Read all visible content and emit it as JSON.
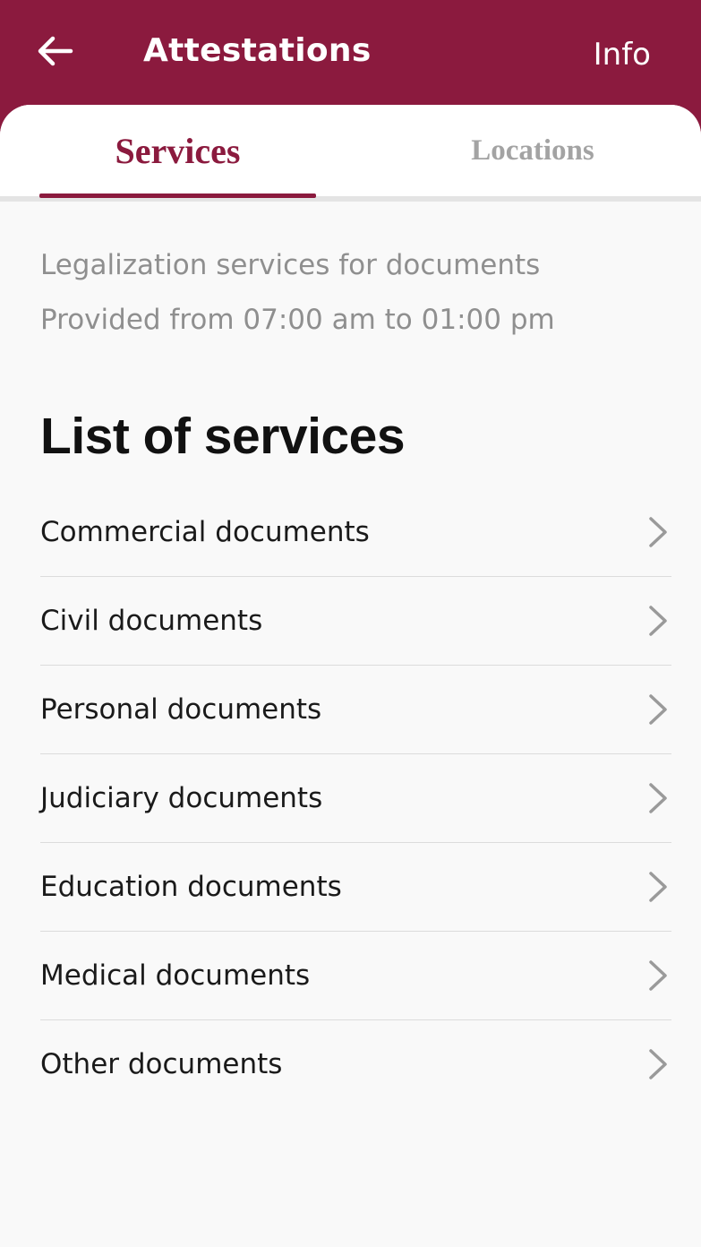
{
  "header": {
    "title": "Attestations",
    "info_label": "Info",
    "back_icon": "arrow-left-icon"
  },
  "tabs": [
    {
      "label": "Services",
      "active": true
    },
    {
      "label": "Locations",
      "active": false
    }
  ],
  "description": {
    "line1": "Legalization services for documents",
    "line2": "Provided from 07:00 am to 01:00 pm"
  },
  "services_section": {
    "title": "List of services",
    "items": [
      {
        "label": "Commercial documents",
        "icon": "chevron-right-icon"
      },
      {
        "label": "Civil documents",
        "icon": "chevron-right-icon"
      },
      {
        "label": "Personal documents",
        "icon": "chevron-right-icon"
      },
      {
        "label": "Judiciary documents",
        "icon": "chevron-right-icon"
      },
      {
        "label": "Education documents",
        "icon": "chevron-right-icon"
      },
      {
        "label": "Medical documents",
        "icon": "chevron-right-icon"
      },
      {
        "label": "Other documents",
        "icon": "chevron-right-icon"
      }
    ]
  },
  "colors": {
    "brand": "#8b1a3e",
    "background": "#f9f9f9",
    "muted_text": "#8f8f8f",
    "inactive_tab": "#a3a3a3",
    "chevron": "#9a9a9a"
  }
}
